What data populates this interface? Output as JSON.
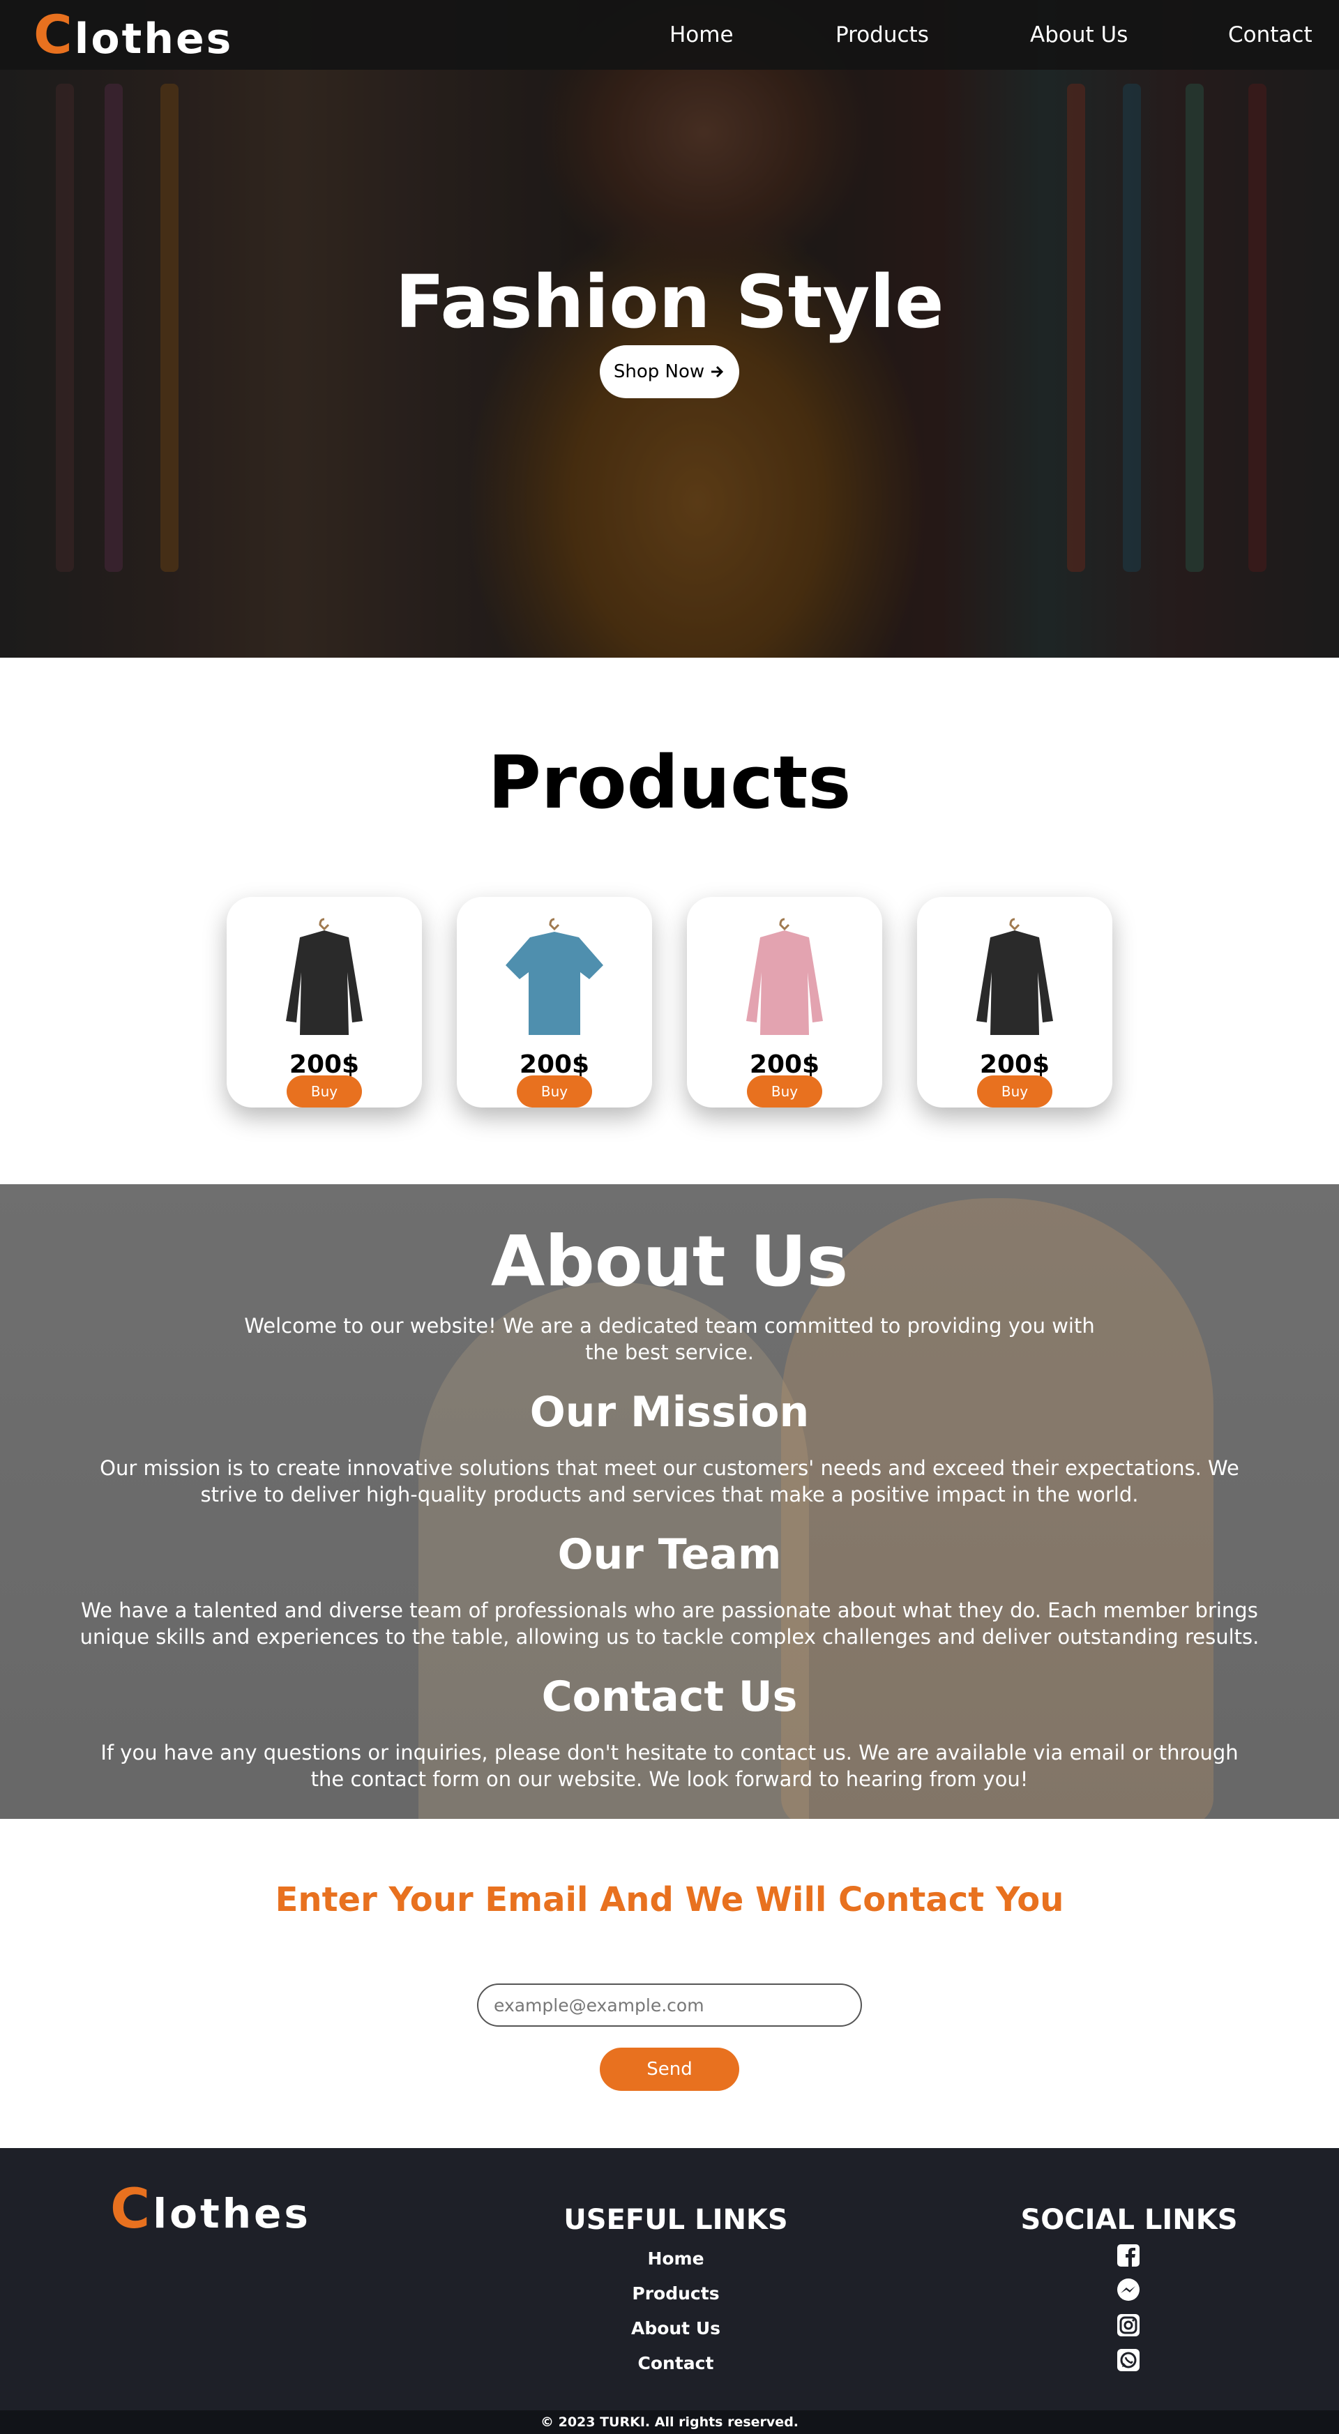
{
  "brand": {
    "first_letter": "C",
    "rest": "lothes"
  },
  "nav": {
    "home": "Home",
    "products": "Products",
    "about": "About Us",
    "contact": "Contact"
  },
  "hero": {
    "title": "Fashion Style",
    "button": "Shop Now",
    "button_icon": "arrow-right-icon"
  },
  "products": {
    "title": "Products",
    "items": [
      {
        "price": "200$",
        "buy": "Buy",
        "color": "#2a2a2a"
      },
      {
        "price": "200$",
        "buy": "Buy",
        "color": "#4f8fae"
      },
      {
        "price": "200$",
        "buy": "Buy",
        "color": "#e3a3b0"
      },
      {
        "price": "200$",
        "buy": "Buy",
        "color": "#2a2a2a"
      }
    ]
  },
  "about": {
    "title": "About Us",
    "intro": "Welcome to our website! We are a dedicated team committed to providing you with the best service.",
    "mission_title": "Our Mission",
    "mission_text": "Our mission is to create innovative solutions that meet our customers' needs and exceed their expectations. We strive to deliver high-quality products and services that make a positive impact in the world.",
    "team_title": "Our Team",
    "team_text": "We have a talented and diverse team of professionals who are passionate about what they do. Each member brings unique skills and experiences to the table, allowing us to tackle complex challenges and deliver outstanding results.",
    "contact_title": "Contact Us",
    "contact_text": "If you have any questions or inquiries, please don't hesitate to contact us. We are available via email or through the contact form on our website. We look forward to hearing from you!"
  },
  "newsletter": {
    "title": "Enter Your Email And We Will Contact You",
    "placeholder": "example@example.com",
    "button": "Send"
  },
  "footer": {
    "useful_title": "USEFUL LINKS",
    "links": [
      "Home",
      "Products",
      "About Us",
      "Contact"
    ],
    "social_title": "SOCIAL LINKS",
    "social_icons": [
      "facebook-icon",
      "messenger-icon",
      "instagram-icon",
      "whatsapp-icon"
    ],
    "copyright": "© 2023 TURKI. All rights reserved."
  },
  "colors": {
    "accent": "#e8711f",
    "footer_bg": "#1e2028"
  }
}
